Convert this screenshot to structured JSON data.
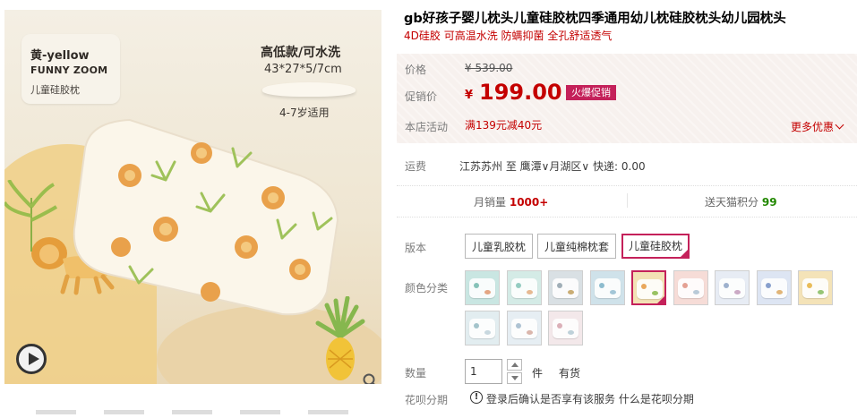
{
  "image": {
    "tag_line1": "黄-yellow",
    "tag_line2": "FUNNY ZOOM",
    "tag_line3": "儿童硅胶枕",
    "spec_line1": "高低款/可水洗",
    "spec_line2": "43*27*5/7cm",
    "spec_line3": "4-7岁适用",
    "play_icon": "play-icon",
    "zoom_icon": "magnifier-icon"
  },
  "product": {
    "title": "gb好孩子婴儿枕头儿童硅胶枕四季通用幼儿枕硅胶枕头幼儿园枕头",
    "subtitle": "4D硅胶 可高温水洗 防螨抑菌 全孔舒适透气"
  },
  "price": {
    "label_price": "价格",
    "original": "¥ 539.00",
    "label_promo": "促销价",
    "currency": "¥",
    "current": "199.00",
    "badge": "火爆促销",
    "label_store_activity": "本店活动",
    "store_activity": "满139元减40元",
    "more_promos": "更多优惠"
  },
  "shipping": {
    "label": "运费",
    "value": "江苏苏州 至 鹰潭∨月湖区∨ 快递: 0.00"
  },
  "stats": {
    "monthly_label": "月销量",
    "monthly_value": "1000+",
    "points_label": "送天猫积分",
    "points_value": "99"
  },
  "version": {
    "label": "版本",
    "options": [
      "儿童乳胶枕",
      "儿童纯棉枕套",
      "儿童硅胶枕"
    ],
    "selected_index": 2
  },
  "colors": {
    "label": "颜色分类",
    "selected_index": 4,
    "swatches": [
      {
        "bg": "#c9e6e2",
        "a": "#7fbfb4",
        "b": "#e8a07a"
      },
      {
        "bg": "#d4ebe6",
        "a": "#8fc9bd",
        "b": "#e9b48a"
      },
      {
        "bg": "#d9e0e4",
        "a": "#9aa9b3",
        "b": "#c9a86a"
      },
      {
        "bg": "#cfe2ea",
        "a": "#86b8cc",
        "b": "#9fc4d6"
      },
      {
        "bg": "#f3e1b5",
        "a": "#e9a253",
        "b": "#8fbf5a"
      },
      {
        "bg": "#f6dcd7",
        "a": "#e39a8c",
        "b": "#b3c9d9"
      },
      {
        "bg": "#e7ecf4",
        "a": "#97abc9",
        "b": "#c9a3c1"
      },
      {
        "bg": "#dde5f3",
        "a": "#7f99c9",
        "b": "#e2b06b"
      },
      {
        "bg": "#f4e3b8",
        "a": "#e8b84f",
        "b": "#8cc26f"
      },
      {
        "bg": "#e2edf0",
        "a": "#9ec0c8",
        "b": "#c6d6de"
      },
      {
        "bg": "#e6eef3",
        "a": "#a8bfd0",
        "b": "#d9b0a5"
      },
      {
        "bg": "#f3e8ea",
        "a": "#d9aab3",
        "b": "#b9cfd8"
      }
    ]
  },
  "quantity": {
    "label": "数量",
    "value": "1",
    "unit": "件",
    "stock": "有货"
  },
  "huabei": {
    "label": "花呗分期",
    "text": "登录后确认是否享有该服务",
    "link": "什么是花呗分期"
  }
}
